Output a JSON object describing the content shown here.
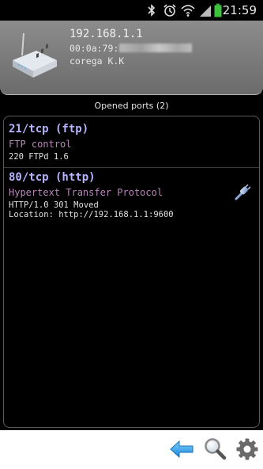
{
  "status_bar": {
    "time": "21:59",
    "icons": [
      "bluetooth-icon",
      "alarm-icon",
      "wifi-icon",
      "signal-icon",
      "battery-icon"
    ]
  },
  "device": {
    "ip": "192.168.1.1",
    "mac_visible": "00:0a:79:",
    "vendor": "corega K.K",
    "icon": "router-icon"
  },
  "ports_section": {
    "title": "Opened ports (2)"
  },
  "ports": [
    {
      "name": "21/tcp (ftp)",
      "description": "FTP control",
      "lines": [
        "220 FTPd 1.6"
      ]
    },
    {
      "name": "80/tcp (http)",
      "description": "Hypertext Transfer Protocol",
      "lines": [
        "HTTP/1.0 301 Moved",
        "Location: http://192.168.1.1:9600"
      ],
      "action_icon": "link-icon"
    }
  ],
  "toolbar": {
    "buttons": [
      "back-icon",
      "search-icon",
      "settings-icon"
    ]
  },
  "colors": {
    "port_name": "#b6b4ff",
    "port_desc": "#b786b8",
    "header_bg": "#7a7a7a",
    "accent_blue": "#3a9fe6"
  }
}
